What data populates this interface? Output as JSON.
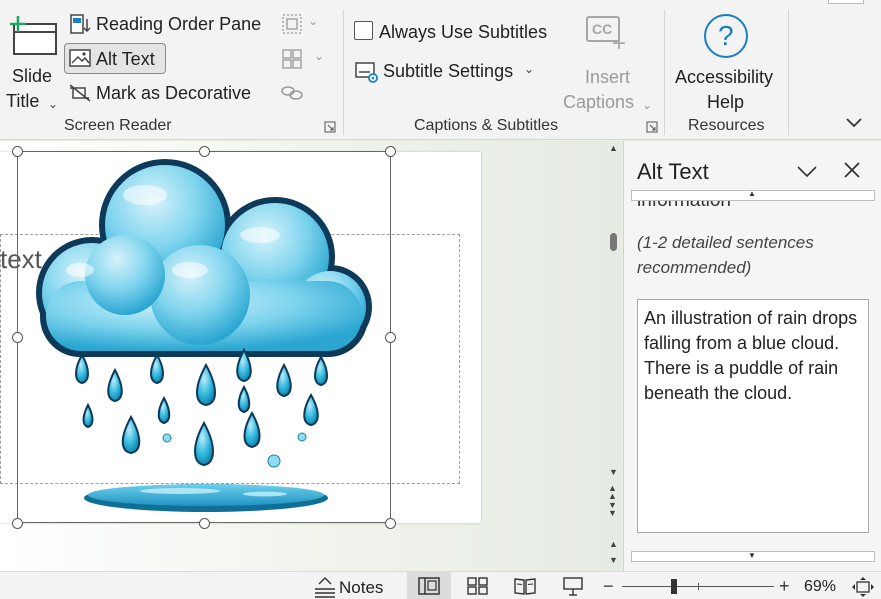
{
  "ribbon": {
    "slide_title": {
      "line1": "Slide",
      "line2": "Title"
    },
    "screen_reader": {
      "reading_order_pane": "Reading Order Pane",
      "alt_text": "Alt Text",
      "mark_as_decorative": "Mark as Decorative",
      "group_label": "Screen Reader"
    },
    "captions": {
      "always_use_subtitles": "Always Use Subtitles",
      "always_use_subtitles_checked": false,
      "subtitle_settings": "Subtitle Settings",
      "insert_captions": {
        "line1": "Insert",
        "line2": "Captions"
      },
      "cc_icon_text": "CC",
      "group_label": "Captions & Subtitles"
    },
    "resources": {
      "accessibility_help": {
        "line1": "Accessibility",
        "line2": "Help"
      },
      "help_icon_text": "?",
      "group_label": "Resources"
    }
  },
  "slide": {
    "placeholder_text": "text"
  },
  "alt_text_pane": {
    "title": "Alt Text",
    "cut_label": "information",
    "hint": "(1-2 detailed sentences recommended)",
    "description": "An illustration of rain drops falling from a blue cloud. There is a puddle of rain beneath the cloud."
  },
  "statusbar": {
    "notes": "Notes",
    "zoom_minus": "−",
    "zoom_plus": "+",
    "zoom_percent": "69%"
  },
  "colors": {
    "cloud_light": "#bfeaf7",
    "cloud_mid": "#4fc3e3",
    "cloud_outline": "#0e3a5a",
    "drop": "#21a6cf",
    "accent_green": "#21a366",
    "help_blue": "#1a7fc1"
  }
}
